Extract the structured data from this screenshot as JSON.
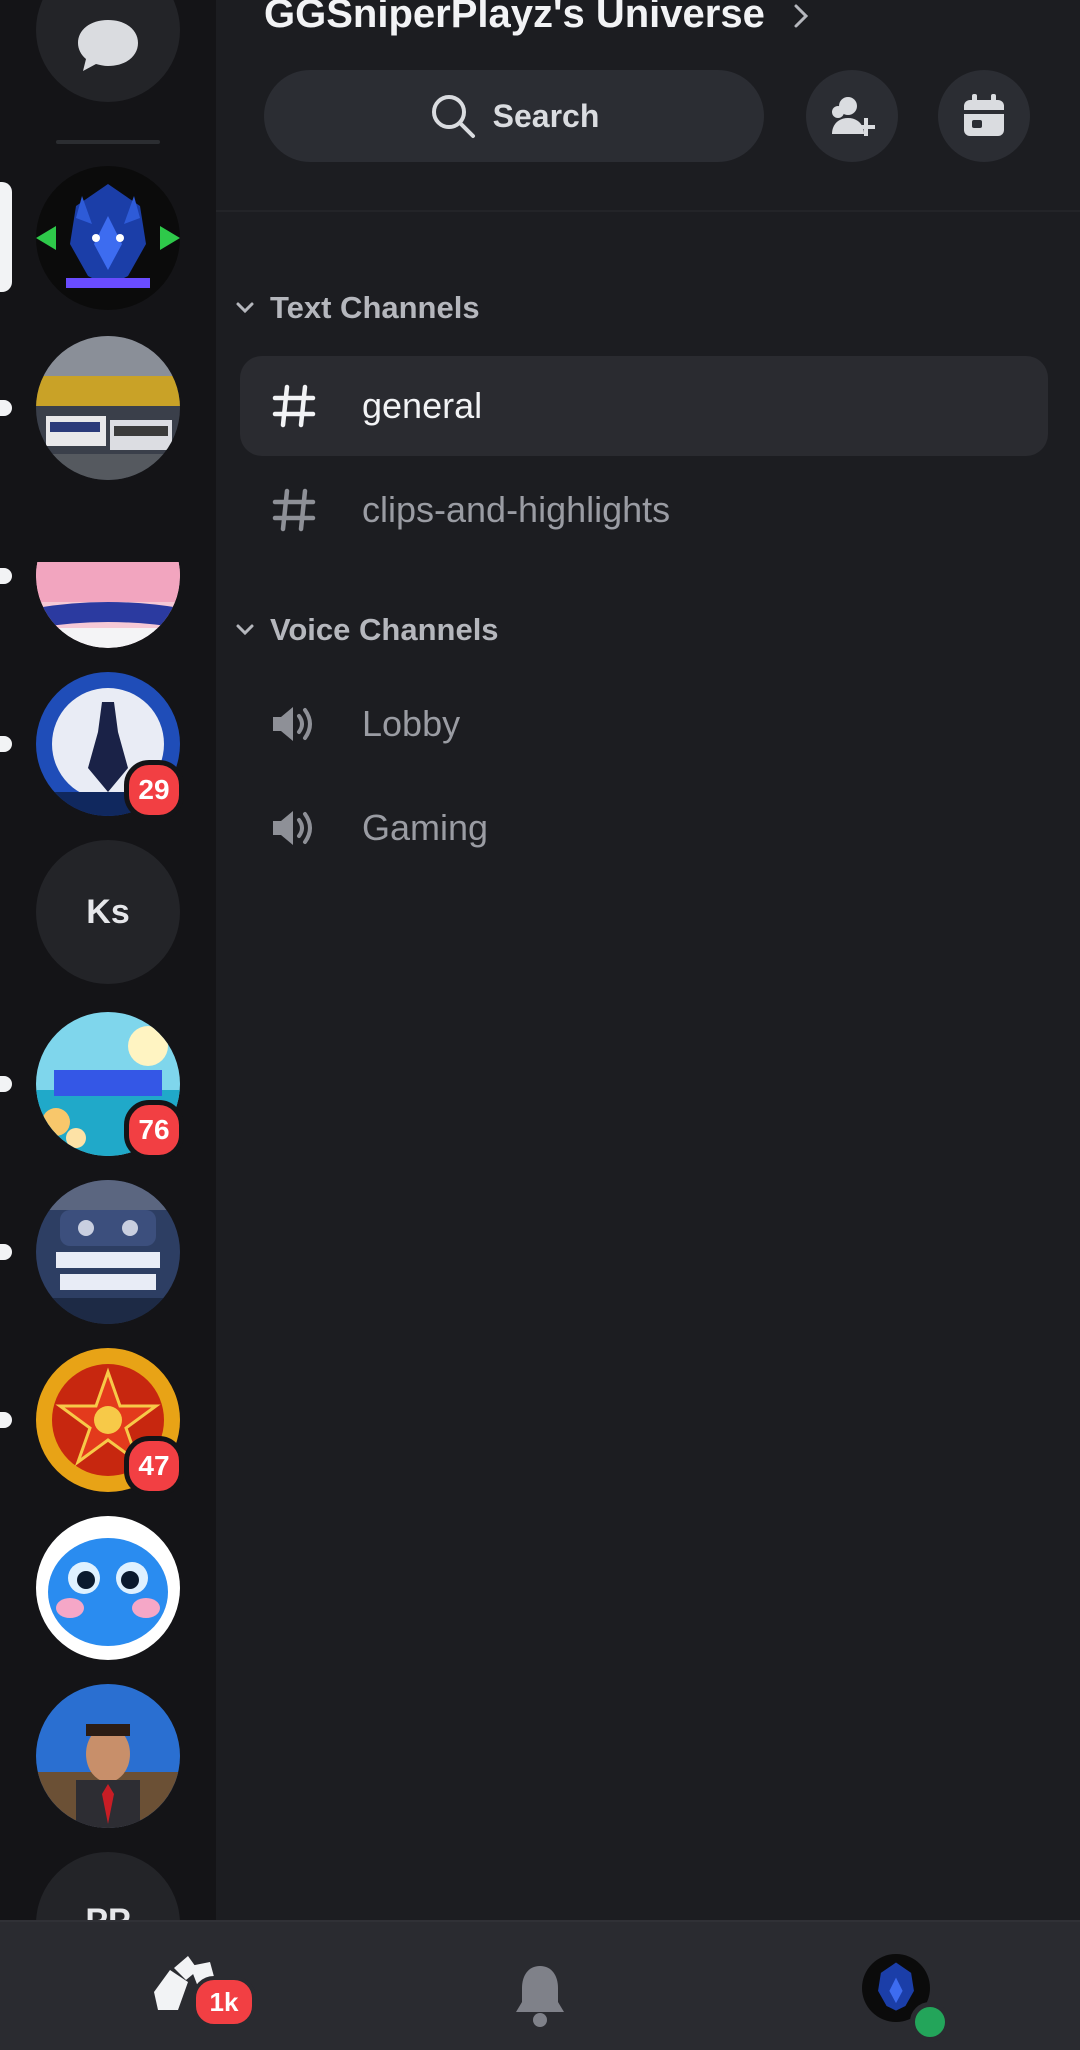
{
  "header": {
    "server_name": "GGSniperPlayz's Universe",
    "search_label": "Search",
    "invite_icon": "add-member-icon",
    "events_icon": "calendar-icon"
  },
  "categories": [
    {
      "label": "Text Channels",
      "channels": [
        {
          "name": "general",
          "type": "text",
          "active": true
        },
        {
          "name": "clips-and-highlights",
          "type": "text",
          "active": false
        }
      ]
    },
    {
      "label": "Voice Channels",
      "channels": [
        {
          "name": "Lobby",
          "type": "voice",
          "active": false
        },
        {
          "name": "Gaming",
          "type": "voice",
          "active": false
        }
      ]
    }
  ],
  "servers": [
    {
      "type": "dm-icon"
    },
    {
      "type": "image",
      "selected": true
    },
    {
      "type": "image",
      "unread": true
    },
    {
      "type": "image",
      "unread": true
    },
    {
      "type": "image",
      "unread": true,
      "badge": "29"
    },
    {
      "type": "text",
      "label": "Ks"
    },
    {
      "type": "image",
      "unread": true,
      "badge": "76"
    },
    {
      "type": "image",
      "unread": true
    },
    {
      "type": "image",
      "unread": true,
      "badge": "47"
    },
    {
      "type": "image"
    },
    {
      "type": "image"
    },
    {
      "type": "text",
      "label": "PP"
    }
  ],
  "bottom_nav": {
    "home_badge": "1k",
    "items": [
      "home-icon",
      "bell-icon",
      "profile-avatar"
    ]
  },
  "colors": {
    "accent_red": "#f23f43",
    "online_green": "#23a55a",
    "background": "#1c1d21"
  }
}
